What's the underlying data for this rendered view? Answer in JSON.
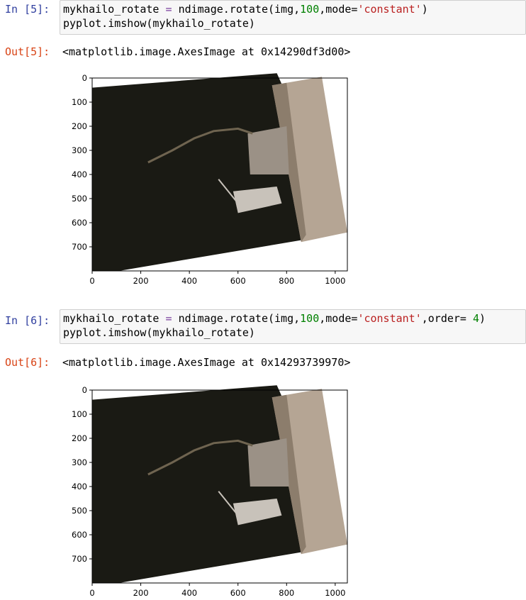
{
  "cells": [
    {
      "in_prompt": "In [5]:",
      "line1": {
        "var": "mykhailo_rotate",
        "eq": " = ",
        "call": "ndimage.rotate(img,",
        "num": "100",
        "mode_kw": ",mode=",
        "mode_val": "'constant'",
        "rest": ")"
      },
      "line2": "pyplot.imshow(mykhailo_rotate)",
      "out_prompt": "Out[5]:",
      "output": "<matplotlib.image.AxesImage at 0x14290df3d00>"
    },
    {
      "in_prompt": "In [6]:",
      "line1": {
        "var": "mykhailo_rotate",
        "eq": " = ",
        "call": "ndimage.rotate(img,",
        "num": "100",
        "mode_kw": ",mode=",
        "mode_val": "'constant'",
        "order_kw": ",order=",
        "order_val": " 4",
        "rest": ")"
      },
      "line2": "pyplot.imshow(mykhailo_rotate)",
      "out_prompt": "Out[6]:",
      "output": "<matplotlib.image.AxesImage at 0x14293739970>"
    }
  ],
  "plot": {
    "y_ticks": [
      "0",
      "100",
      "200",
      "300",
      "400",
      "500",
      "600",
      "700"
    ],
    "x_ticks": [
      "0",
      "200",
      "400",
      "600",
      "800",
      "1000"
    ],
    "colors": {
      "background": "#1a1a14",
      "wall": "#b5a594",
      "wall_shadow": "#8c7d6c",
      "branch": "#6f6450",
      "vase": "#9b9186",
      "glass": "#c8c2ba"
    }
  }
}
